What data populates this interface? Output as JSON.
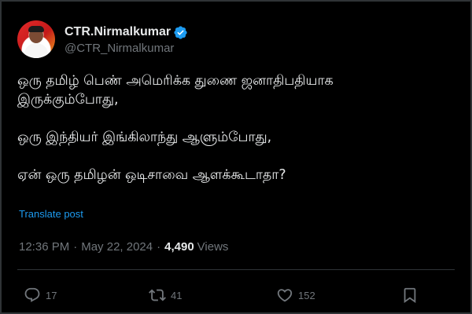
{
  "author": {
    "display_name": "CTR.Nirmalkumar",
    "handle": "@CTR_Nirmalkumar",
    "verified": true,
    "verified_color": "#1d9bf0"
  },
  "post": {
    "lines": [
      "ஒரு தமிழ் பெண் அமெரிக்க துணை ஜனாதிபதியாக",
      "இருக்கும்போது,",
      "",
      "ஒரு இந்தியர் இங்கிலாந்து ஆளும்போது,",
      "",
      "ஏன் ஒரு தமிழன் ஒடிசாவை ஆளக்கூடாதா?"
    ],
    "translate_label": "Translate post"
  },
  "meta": {
    "time": "12:36 PM",
    "separator": "·",
    "date": "May 22, 2024",
    "views_count": "4,490",
    "views_label": "Views"
  },
  "actions": {
    "replies": "17",
    "reposts": "41",
    "likes": "152"
  },
  "icons": {
    "reply": "reply-icon",
    "repost": "repost-icon",
    "like": "heart-icon",
    "bookmark": "bookmark-icon"
  },
  "colors": {
    "background": "#000000",
    "text": "#e7e9ea",
    "muted": "#71767b",
    "accent": "#1d9bf0",
    "border": "#2f3336"
  }
}
